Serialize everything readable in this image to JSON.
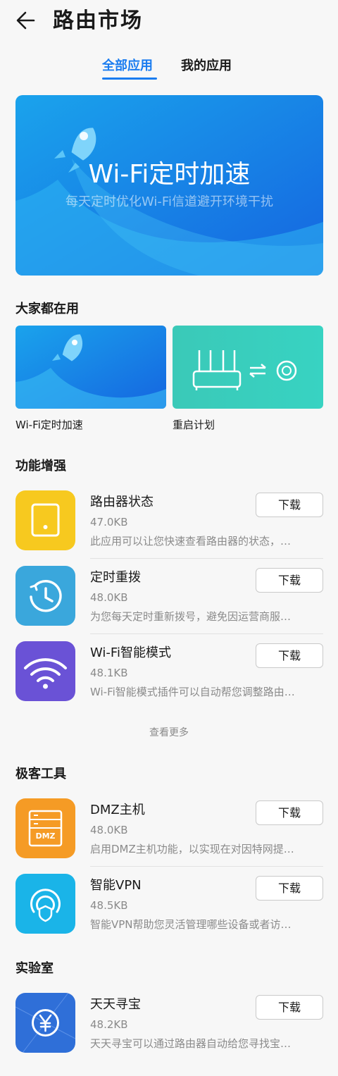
{
  "header": {
    "title": "路由市场",
    "back_icon": "arrow-left-icon"
  },
  "tabs": [
    {
      "label": "全部应用",
      "active": true
    },
    {
      "label": "我的应用",
      "active": false
    }
  ],
  "banner": {
    "title": "Wi-Fi定时加速",
    "subtitle": "每天定时优化Wi-Fi信道避开环境干扰"
  },
  "popular": {
    "title": "大家都在用",
    "items": [
      {
        "label": "Wi-Fi定时加速",
        "icon": "rocket-icon"
      },
      {
        "label": "重启计划",
        "icon": "router-restart-icon"
      }
    ]
  },
  "features": {
    "title": "功能增强",
    "items": [
      {
        "name": "路由器状态",
        "size": "47.0KB",
        "desc": "此应用可以让您快速查看路由器的状态，…",
        "button": "下载",
        "icon": "router-status-icon",
        "color": "#f7c91f"
      },
      {
        "name": "定时重拨",
        "size": "48.0KB",
        "desc": "为您每天定时重新拨号，避免因运营商服…",
        "button": "下载",
        "icon": "clock-history-icon",
        "color": "#3aa7dc"
      },
      {
        "name": "Wi-Fi智能模式",
        "size": "48.1KB",
        "desc": "Wi-Fi智能模式插件可以自动帮您调整路由…",
        "button": "下载",
        "icon": "wifi-icon",
        "color": "#6a52d6"
      }
    ],
    "see_more": "查看更多"
  },
  "geek": {
    "title": "极客工具",
    "items": [
      {
        "name": "DMZ主机",
        "size": "48.0KB",
        "desc": "启用DMZ主机功能，以实现在对因特网提…",
        "button": "下载",
        "icon": "dmz-server-icon",
        "icon_text": "DMZ",
        "color": "#f59b25"
      },
      {
        "name": "智能VPN",
        "size": "48.5KB",
        "desc": "智能VPN帮助您灵活管理哪些设备或者访…",
        "button": "下载",
        "icon": "vpn-shield-icon",
        "color": "#1ab4e8"
      }
    ]
  },
  "lab": {
    "title": "实验室",
    "items": [
      {
        "name": "天天寻宝",
        "size": "48.2KB",
        "desc": "天天寻宝可以通过路由器自动给您寻找宝…",
        "button": "下载",
        "icon": "yuan-coin-icon",
        "color": "#2f6fd8"
      }
    ]
  }
}
